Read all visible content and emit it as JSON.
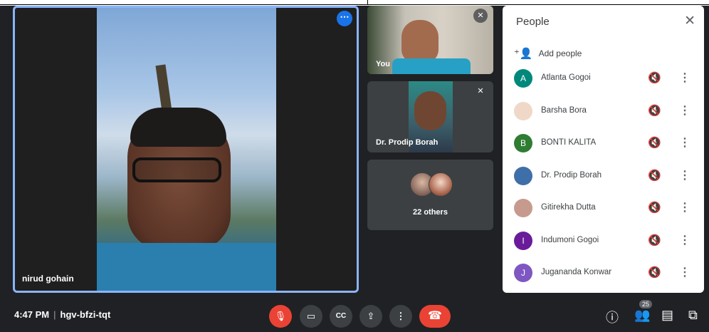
{
  "meeting": {
    "time": "4:47 PM",
    "code": "hgv-bfzi-tqt"
  },
  "main_tile": {
    "name": "nirud gohain"
  },
  "side_tiles": {
    "you": "You",
    "dr": "Dr. Prodip Borah",
    "others": "22 others"
  },
  "people_panel": {
    "title": "People",
    "add_people": "Add people",
    "participants": [
      {
        "initial": "A",
        "name": "Atlanta Gogoi",
        "color": "#00897b"
      },
      {
        "initial": "",
        "name": "Barsha Bora",
        "color": "#f0d8c8"
      },
      {
        "initial": "B",
        "name": "BONTI KALITA",
        "color": "#2e7d32"
      },
      {
        "initial": "",
        "name": "Dr. Prodip Borah",
        "color": "#3f6fa8"
      },
      {
        "initial": "",
        "name": "Gitirekha Dutta",
        "color": "#c79a8e"
      },
      {
        "initial": "I",
        "name": "Indumoni Gogoi",
        "color": "#6a1b9a"
      },
      {
        "initial": "J",
        "name": "Jugananda Konwar",
        "color": "#7e57c2"
      }
    ]
  },
  "controls": {
    "cc": "CC",
    "people_count": "25"
  },
  "colors": {
    "accent": "#8ab4f8",
    "end_call": "#ea4335",
    "bg": "#202124"
  }
}
